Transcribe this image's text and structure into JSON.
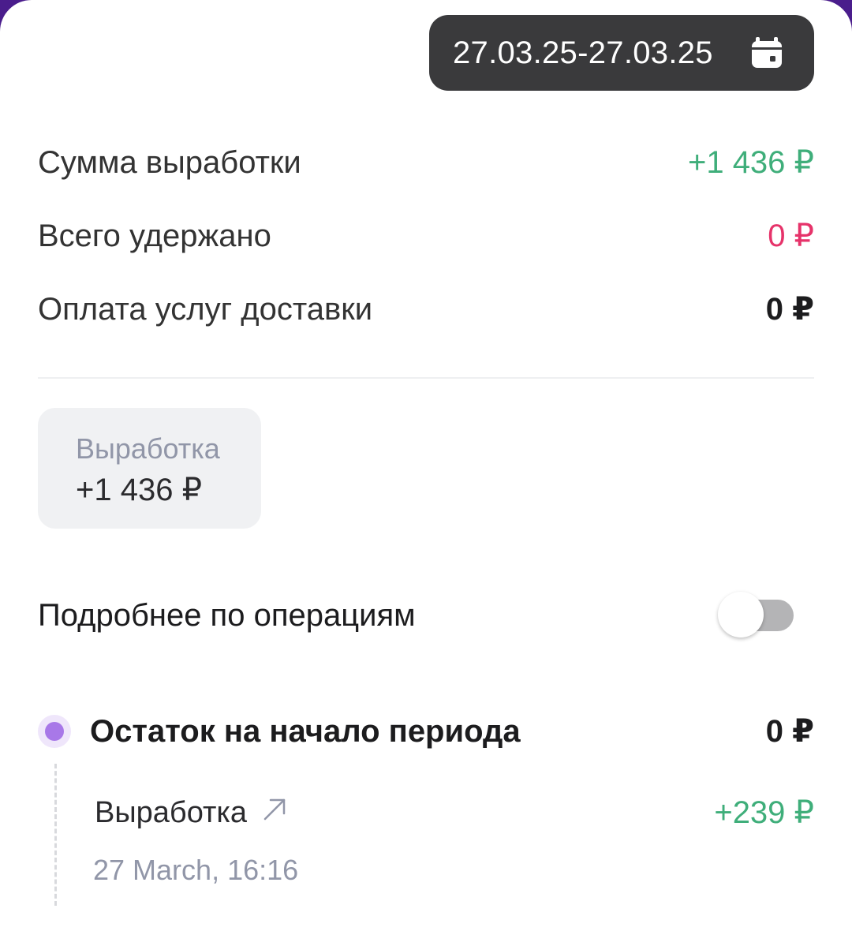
{
  "period": {
    "range": "27.03.25-27.03.25",
    "icon": "calendar-icon"
  },
  "summary": {
    "earnings_label": "Сумма выработки",
    "earnings_value": "+1 436 ₽",
    "withheld_label": "Всего удержано",
    "withheld_value": "0 ₽",
    "delivery_label": "Оплата услуг доставки",
    "delivery_value": "0 ₽"
  },
  "filter_chip": {
    "label": "Выработка",
    "value": "+1 436 ₽"
  },
  "details_toggle": {
    "label": "Подробнее по операциям",
    "state": "off"
  },
  "timeline": {
    "start_balance_label": "Остаток на начало периода",
    "start_balance_value": "0 ₽",
    "operations": [
      {
        "label": "Выработка",
        "value": "+239 ₽",
        "date": "27 March, 16:16",
        "icon": "arrow-up-right-icon"
      }
    ]
  },
  "colors": {
    "positive": "#3fae7a",
    "negative": "#e6336a",
    "accent": "#a878e8",
    "pill_bg": "#3a3a3c"
  }
}
